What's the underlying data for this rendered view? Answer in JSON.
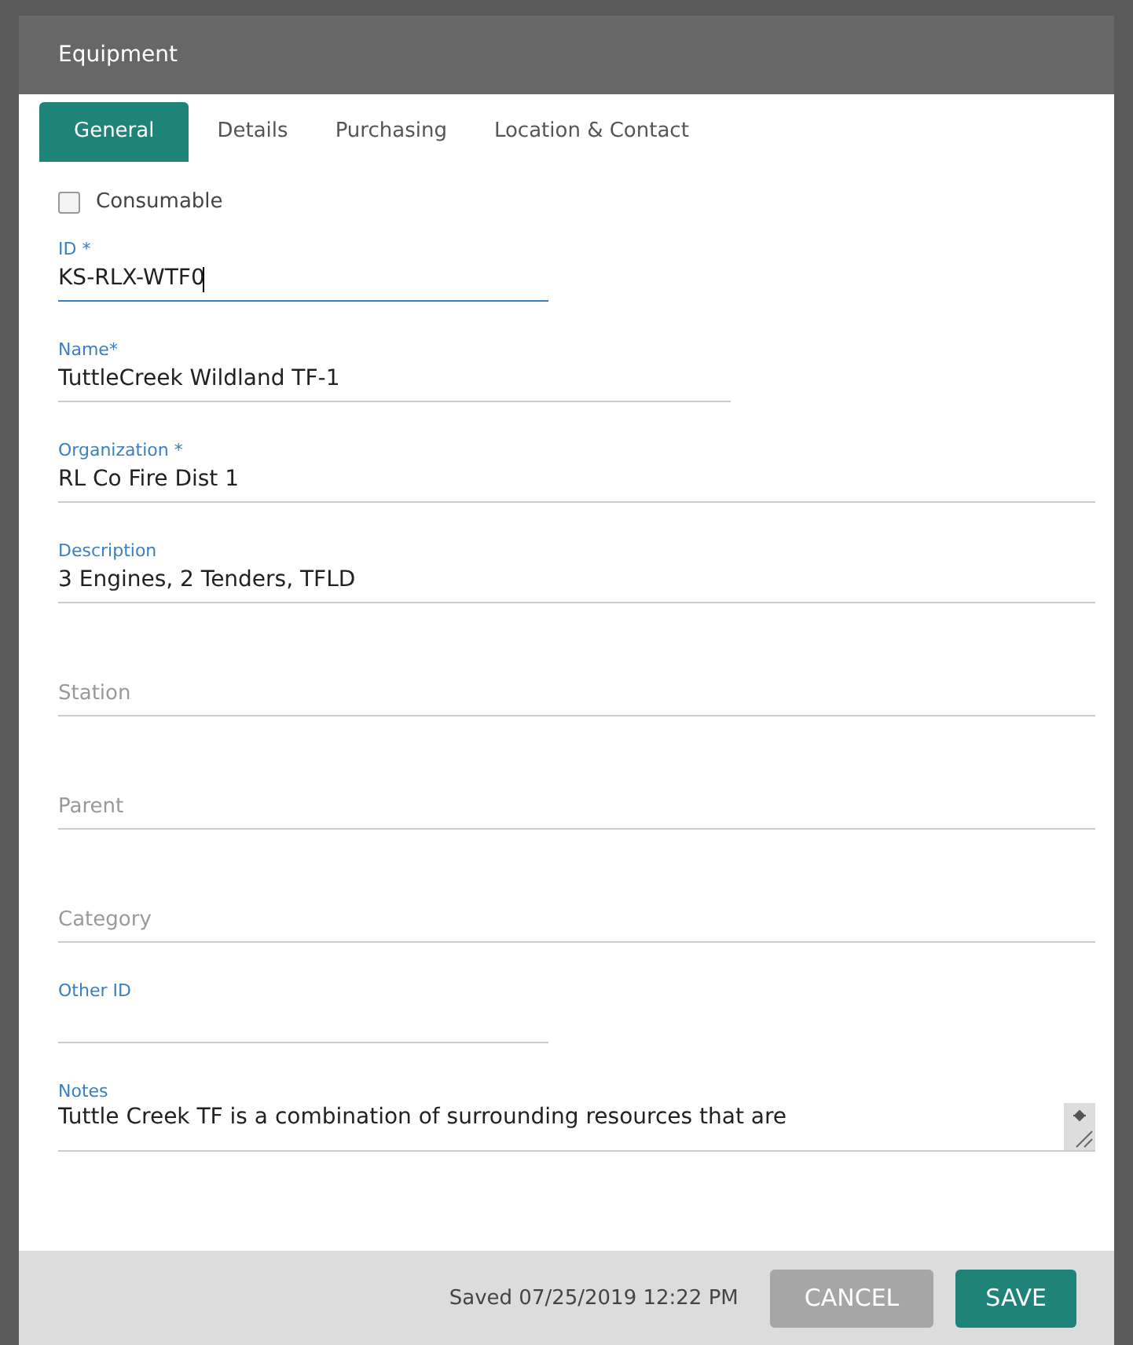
{
  "window": {
    "title": "Equipment"
  },
  "tabs": [
    {
      "label": "General",
      "selected": true
    },
    {
      "label": "Details",
      "selected": false
    },
    {
      "label": "Purchasing",
      "selected": false
    },
    {
      "label": "Location & Contact",
      "selected": false
    }
  ],
  "consumable": {
    "label": "Consumable",
    "checked": false
  },
  "fields": [
    {
      "kind": "text",
      "label": "ID *",
      "value": "KS-RLX-WTF0",
      "focused": true
    },
    {
      "kind": "text",
      "label": "Name*",
      "value": "TuttleCreek Wildland TF-1",
      "focused": false
    },
    {
      "kind": "text",
      "label": "Organization *",
      "value": "RL Co Fire Dist 1",
      "focused": false
    },
    {
      "kind": "text",
      "label": "Description",
      "value": "3 Engines, 2 Tenders, TFLD",
      "focused": false
    },
    {
      "kind": "text",
      "placeholder": "Station",
      "focused": false
    },
    {
      "kind": "text",
      "placeholder": "Parent",
      "focused": false
    },
    {
      "kind": "text",
      "placeholder": "Category",
      "focused": false
    },
    {
      "kind": "text",
      "label": "Other ID",
      "focused": false
    },
    {
      "kind": "textarea",
      "label": "Notes",
      "value": "Tuttle Creek TF is a combination of surrounding resources that are",
      "focused": false
    }
  ],
  "footer": {
    "status": "Saved 07/25/2019 12:22 PM",
    "buttons": [
      {
        "label": "CANCEL",
        "kind": "secondary"
      },
      {
        "label": "SAVE",
        "kind": "primary"
      }
    ]
  }
}
